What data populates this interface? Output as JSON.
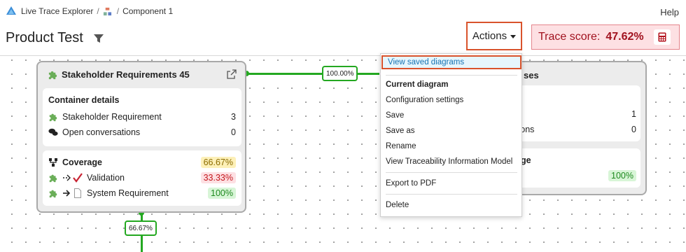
{
  "breadcrumb": {
    "app_name": "Live Trace Explorer",
    "separator": "/",
    "component": "Component 1"
  },
  "help_label": "Help",
  "page_title": "Product Test",
  "actions_label": "Actions",
  "trace_score": {
    "label": "Trace score:",
    "value": "47.62%"
  },
  "left_card": {
    "title": "Stakeholder Requirements 45",
    "container_details": {
      "heading": "Container details",
      "rows": [
        {
          "label": "Stakeholder Requirement",
          "value": "3"
        },
        {
          "label": "Open conversations",
          "value": "0"
        }
      ]
    },
    "coverage": {
      "heading": "Coverage",
      "value": "66.67%",
      "rows": [
        {
          "label": "Validation",
          "value": "33.33%"
        },
        {
          "label": "System Requirement",
          "value": "100%"
        }
      ]
    }
  },
  "right_card": {
    "title_fragment": "ses",
    "row1_value": "1",
    "row2_fragment": "tions",
    "row2_value": "0",
    "coverage_fragment": "age",
    "coverage_value": "100%"
  },
  "connectors": {
    "horizontal_label": "100.00%",
    "vertical_label": "66.67%"
  },
  "menu": {
    "view_saved": "View saved diagrams",
    "current_heading": "Current diagram",
    "items": [
      "Configuration settings",
      "Save",
      "Save as",
      "Rename",
      "View Traceability Information Model"
    ],
    "export": "Export to PDF",
    "delete": "Delete"
  },
  "colors": {
    "accent_green": "#24a821",
    "highlight_border": "#d9532c",
    "score_red": "#a1121f",
    "menu_active_bg": "#e6f6fd"
  }
}
